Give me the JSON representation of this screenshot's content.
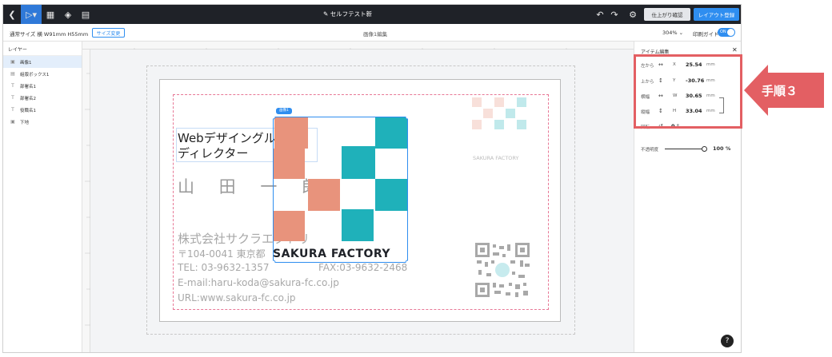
{
  "topbar": {
    "doc_title": "セルフテスト新",
    "preview_btn": "仕上がり確認",
    "register_btn": "レイアウト登録"
  },
  "subbar": {
    "size_label": "通常サイズ 横 W91mm H55mm",
    "size_change": "サイズ変更",
    "edit_label": "画像1編集",
    "zoom": "304%",
    "print_guide": "印刷ガイド",
    "toggle": "ON"
  },
  "layers": {
    "title": "レイヤー",
    "items": [
      {
        "icon": "image-icon",
        "label": "画像1",
        "selected": true
      },
      {
        "icon": "textbox-icon",
        "label": "組版ボックス1",
        "selected": false
      },
      {
        "icon": "text-icon",
        "label": "部署名1",
        "selected": false
      },
      {
        "icon": "text-icon",
        "label": "部署名2",
        "selected": false
      },
      {
        "icon": "text-icon",
        "label": "役職名1",
        "selected": false
      },
      {
        "icon": "image-icon",
        "label": "下地",
        "selected": false
      }
    ]
  },
  "card": {
    "title_line1": "Webデザイングループ",
    "title_line2": "ディレクター",
    "name": "山 田 一 郎",
    "company": "株式会社サクラエクトリ",
    "address": "〒104-0041 東京都",
    "tel": "TEL: 03-9632-1357",
    "fax": "FAX:03-9632-2468",
    "email": "E-mail:haru-koda@sakura-fc.co.jp",
    "url": "URL:www.sakura-fc.co.jp",
    "logo_text": "SAKURA FACTORY",
    "logo_faded_text": "SAKURA FACTORY",
    "selection_tag": "画像1",
    "logo_colors": {
      "salmon": "#e8937c",
      "teal": "#1fb1ba"
    }
  },
  "props": {
    "title": "アイテム編集",
    "rows": [
      {
        "label": "左から",
        "axis": "X",
        "value": "25.54",
        "unit": "mm"
      },
      {
        "label": "上から",
        "axis": "Y",
        "value": "-30.76",
        "unit": "mm"
      },
      {
        "label": "横幅",
        "axis": "W",
        "value": "30.65",
        "unit": "mm"
      },
      {
        "label": "縦幅",
        "axis": "H",
        "value": "33.04",
        "unit": "mm"
      },
      {
        "label": "回転",
        "axis": "",
        "value": "0 °",
        "unit": ""
      }
    ],
    "opacity_label": "不透明度",
    "opacity_value": "100 %"
  },
  "annotation": {
    "step_label": "手順３",
    "color": "#e35f63"
  },
  "help": "?"
}
